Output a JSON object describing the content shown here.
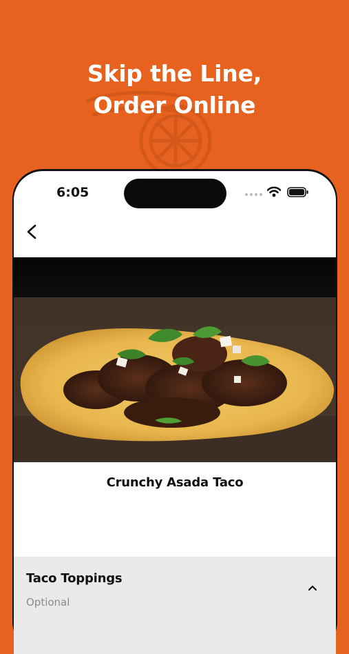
{
  "promo": {
    "headline_line1": "Skip the Line,",
    "headline_line2": "Order Online",
    "background_color": "#E8621F"
  },
  "status_bar": {
    "time": "6:05",
    "icons": [
      "signal-dots-icon",
      "wifi-icon",
      "battery-icon"
    ]
  },
  "nav": {
    "back_icon": "chevron-left-icon"
  },
  "item": {
    "name": "Crunchy Asada Taco"
  },
  "options_section": {
    "title": "Taco Toppings",
    "subtitle": "Optional",
    "expander_icon": "chevron-up-icon"
  }
}
